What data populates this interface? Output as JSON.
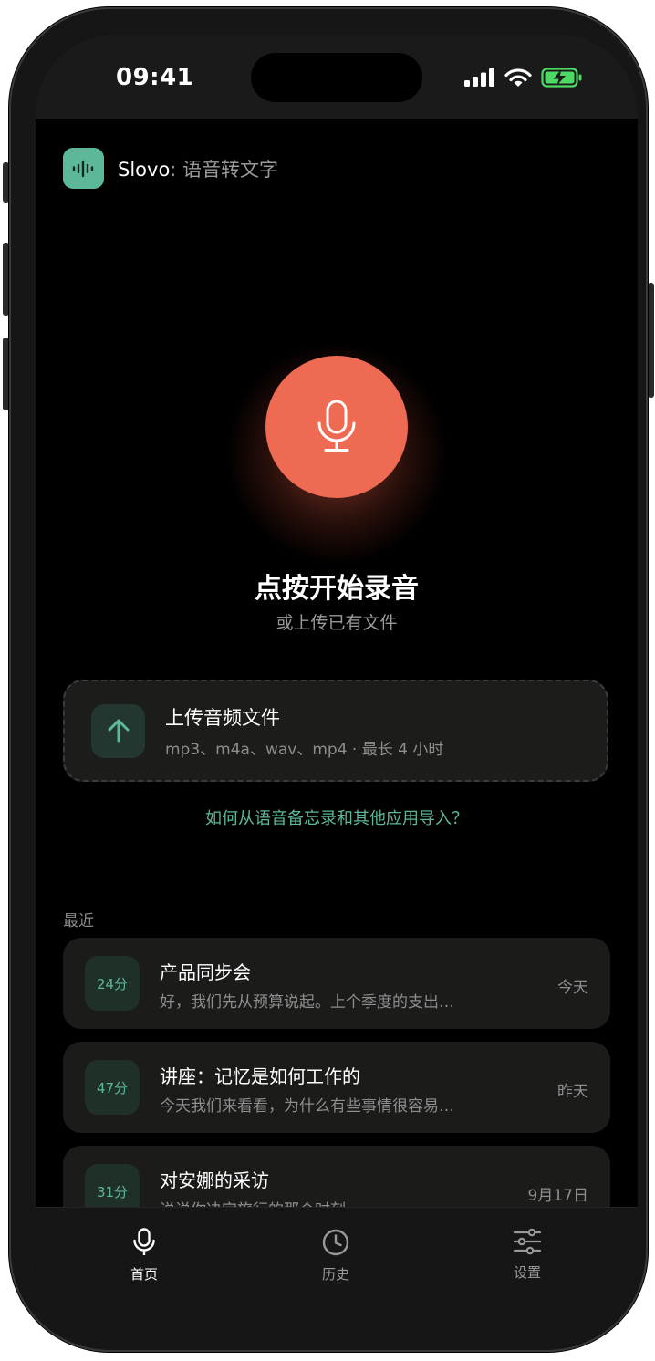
{
  "status_bar": {
    "time": "09:41",
    "icons": [
      "signal-icon",
      "wifi-icon",
      "battery-charging-icon"
    ],
    "battery_color": "#4cd964"
  },
  "app": {
    "name": "Slovo",
    "subtitle": ": 语音转文字",
    "logo_icon": "waveform-icon",
    "accent": "#5db89a"
  },
  "record": {
    "button_icon": "microphone-icon",
    "button_color": "#ee6a52",
    "title": "点按开始录音",
    "subtitle": "或上传已有文件"
  },
  "upload": {
    "icon": "arrow-up-icon",
    "title": "上传音频文件",
    "formats": "mp3、m4a、wav、mp4 · 最长 4 小时"
  },
  "help_link": "如何从语音备忘录和其他应用导入？",
  "recent": {
    "label": "最近",
    "items": [
      {
        "duration": "24分",
        "title": "产品同步会",
        "preview": "好，我们先从预算说起。上个季度的支出…",
        "date": "今天"
      },
      {
        "duration": "47分",
        "title": "讲座：记忆是如何工作的",
        "preview": "今天我们来看看，为什么有些事情很容易…",
        "date": "昨天"
      },
      {
        "duration": "31分",
        "title": "对安娜的采访",
        "preview": "说说你决定旅行的那个时刻",
        "date": "9月17日"
      }
    ]
  },
  "tab_bar": {
    "tabs": [
      {
        "label": "首页",
        "icon": "microphone-icon",
        "active": true
      },
      {
        "label": "历史",
        "icon": "clock-icon",
        "active": false
      },
      {
        "label": "设置",
        "icon": "sliders-icon",
        "active": false
      }
    ]
  }
}
